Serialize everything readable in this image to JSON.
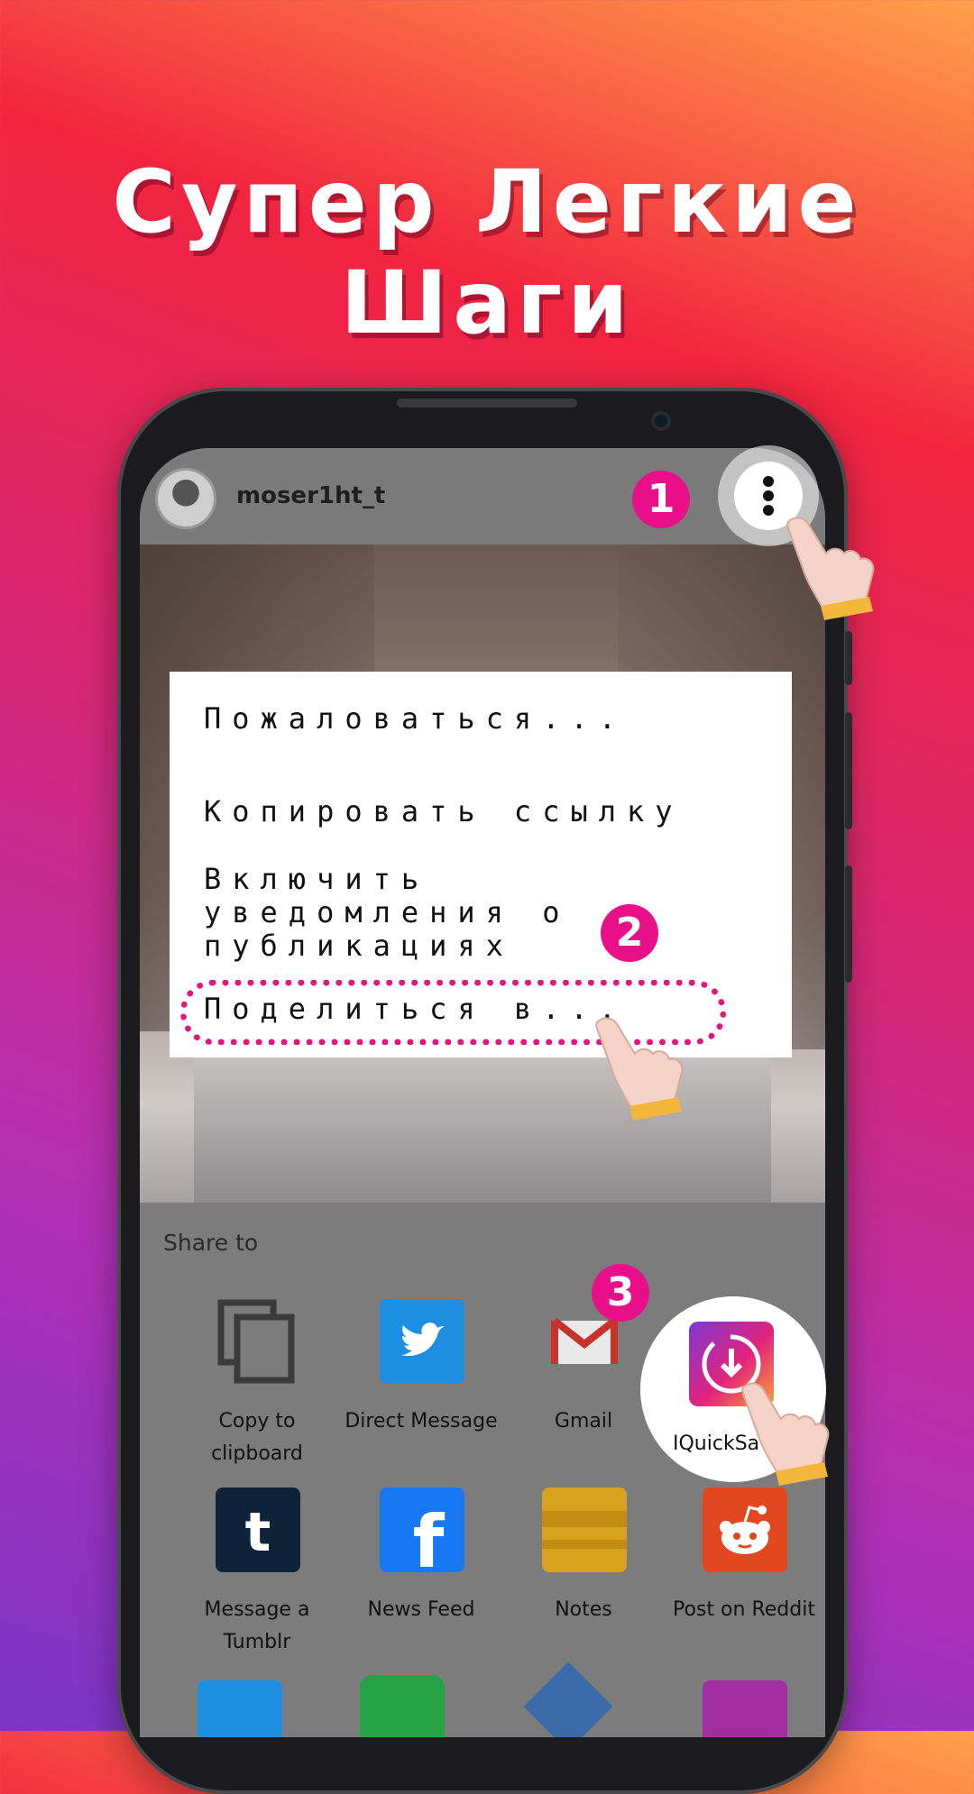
{
  "headline": "Супер Легкие Шаги",
  "post": {
    "username": "moser1ht_t"
  },
  "menu": {
    "items": [
      "Пожаловаться...",
      "Копировать ссылку",
      "Включить",
      "уведомления о",
      "публикациях",
      "Поделиться в..."
    ]
  },
  "share": {
    "title": "Share to",
    "apps": [
      {
        "label": "Copy to clipboard",
        "icon": "copy-icon"
      },
      {
        "label": "Direct Message",
        "icon": "twitter-icon"
      },
      {
        "label": "Gmail",
        "icon": "gmail-icon"
      },
      {
        "label": "IQuickSa",
        "icon": "iquicksave-icon"
      },
      {
        "label": "Message a Tumblr",
        "icon": "tumblr-icon"
      },
      {
        "label": "News Feed",
        "icon": "facebook-icon"
      },
      {
        "label": "Notes",
        "icon": "notes-icon"
      },
      {
        "label": "Post on Reddit",
        "icon": "reddit-icon"
      }
    ]
  },
  "steps": [
    "1",
    "2",
    "3"
  ],
  "colors": {
    "accent": "#e80f89",
    "twitter": "#1d8fe0",
    "facebook": "#1877f2",
    "tumblr": "#0e2238",
    "reddit": "#e2481f",
    "notes": "#d8a21e"
  }
}
